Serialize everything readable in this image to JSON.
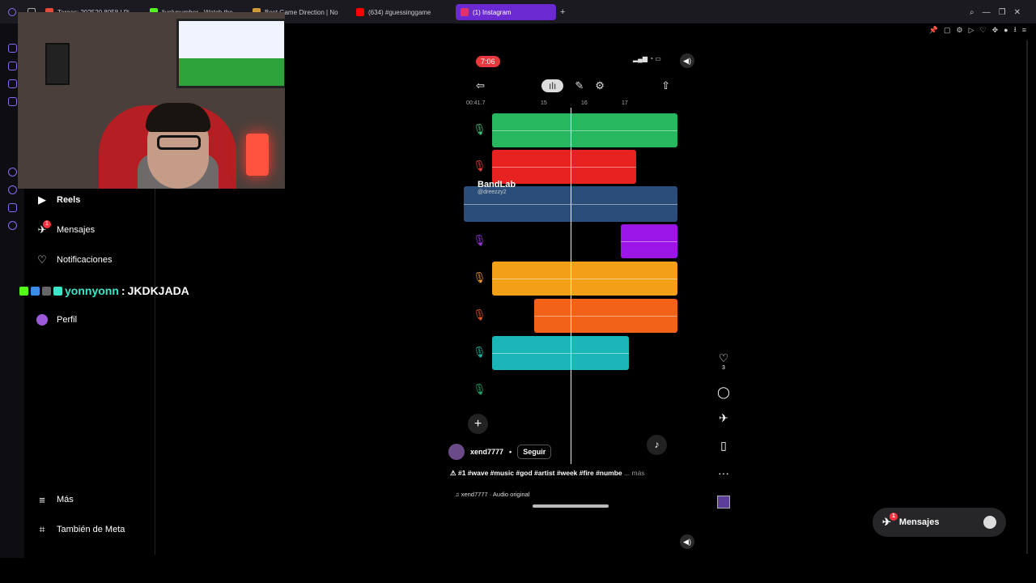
{
  "browser": {
    "tabs": [
      {
        "label": "Tareas: 202520.8058 | Pi",
        "color": "#e34b3a"
      },
      {
        "label": "livelynumber - Watch the",
        "color": "#53fc18"
      },
      {
        "label": "Best Game Direction | No",
        "color": "#d09b3a"
      },
      {
        "label": "(634) #guessinggame",
        "color": "#ff0000"
      },
      {
        "label": "(1) Instagram",
        "color": "#e1306c"
      }
    ],
    "new_tab": "+"
  },
  "sidebar": {
    "items": [
      {
        "label": "Reels",
        "icon": "reels-icon"
      },
      {
        "label": "Mensajes",
        "icon": "send-icon",
        "badge": "1"
      },
      {
        "label": "Notificaciones",
        "icon": "heart-icon"
      },
      {
        "label": "Perfil",
        "icon": "avatar"
      },
      {
        "label": "Más",
        "icon": "menu-icon"
      },
      {
        "label": "También de Meta",
        "icon": "meta-icon"
      }
    ]
  },
  "chat": {
    "user": "yonnyonn",
    "sep": ":",
    "message": "JKDKJADA"
  },
  "reel": {
    "status_time": "7:06",
    "ruler_time": "00:41.7",
    "ruler_marks": [
      "15",
      "16",
      "17"
    ],
    "watermark": "BandLab",
    "watermark_handle": "@dreezzy2",
    "tracks": [
      {
        "color": "#27b85f",
        "mic": "#3ec27a"
      },
      {
        "color": "#e82121",
        "mic": "#e34040"
      },
      {
        "color": "#2a4d7a",
        "mic": "#4a84c9"
      },
      {
        "color": "#9b16e6",
        "mic": "#9b38e0"
      },
      {
        "color": "#f2a018",
        "mic": "#e3932a"
      },
      {
        "color": "#f26218",
        "mic": "#e0552a"
      },
      {
        "color": "#1bb6b8",
        "mic": "#22b5a0"
      },
      {
        "color": "#27b85f",
        "mic": "#22a86a"
      }
    ],
    "author": "xend7777",
    "dot": "•",
    "follow": "Seguir",
    "caption": "#1 #wave #music #god #artist #week #fire #numbe",
    "more": "... más",
    "audio": "xend7777 · Audio original",
    "likes": "3"
  },
  "messages_panel": {
    "label": "Mensajes",
    "badge": "1"
  }
}
